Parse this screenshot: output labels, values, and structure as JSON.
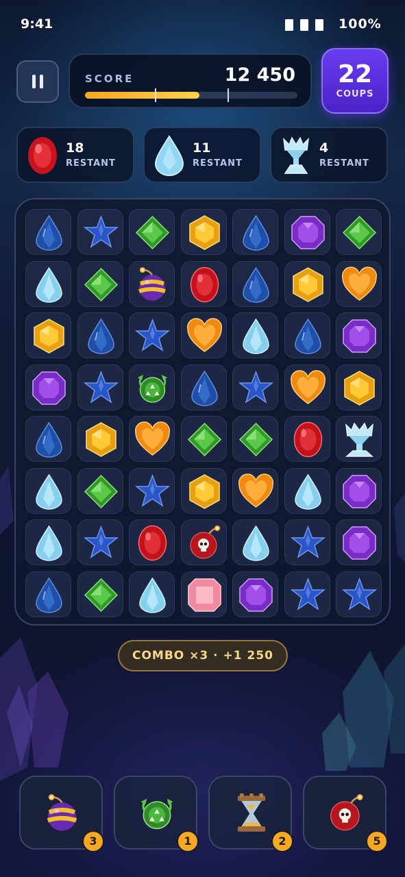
{
  "status_bar": {
    "time": "9:41",
    "battery": "100%"
  },
  "header": {
    "score_label": "SCORE",
    "score_value": "12 450",
    "score_progress": 0.54,
    "score_markers": [
      0.33,
      0.67
    ],
    "moves_value": "22",
    "moves_label": "COUPS"
  },
  "objectives": [
    {
      "icon": "red-gem-icon",
      "count": "18",
      "label": "RESTANT"
    },
    {
      "icon": "ice-drop-icon",
      "count": "11",
      "label": "RESTANT"
    },
    {
      "icon": "ice-chalice-icon",
      "count": "4",
      "label": "RESTANT"
    }
  ],
  "board": {
    "rows": [
      [
        "blue-drop",
        "blue-star",
        "green-diamond",
        "yellow-hex",
        "blue-drop",
        "purple-octagon",
        "green-diamond"
      ],
      [
        "ice-drop",
        "green-diamond",
        "bomb",
        "red-oval",
        "blue-drop",
        "yellow-hex",
        "orange-heart"
      ],
      [
        "yellow-hex",
        "blue-drop",
        "blue-star",
        "orange-heart",
        "ice-drop",
        "blue-drop",
        "purple-octagon"
      ],
      [
        "purple-octagon",
        "blue-star",
        "shuffle",
        "blue-drop",
        "blue-star",
        "orange-heart",
        "yellow-hex"
      ],
      [
        "blue-drop",
        "yellow-hex",
        "orange-heart",
        "green-diamond",
        "green-diamond",
        "red-oval",
        "ice-chalice"
      ],
      [
        "ice-drop",
        "green-diamond",
        "blue-star",
        "yellow-hex",
        "orange-heart",
        "ice-drop",
        "purple-octagon"
      ],
      [
        "ice-drop",
        "blue-star",
        "red-oval",
        "skull-bomb",
        "ice-drop",
        "blue-star",
        "purple-octagon"
      ],
      [
        "blue-drop",
        "green-diamond",
        "ice-drop",
        "pink-square",
        "purple-octagon",
        "blue-star",
        "blue-star"
      ]
    ]
  },
  "combo": {
    "text": "COMBO ×3 · +1 250"
  },
  "boosters": [
    {
      "icon": "bomb",
      "name": "bomb-booster",
      "count": "3"
    },
    {
      "icon": "shuffle",
      "name": "shuffle-booster",
      "count": "1"
    },
    {
      "icon": "hourglass",
      "name": "hourglass-booster",
      "count": "2"
    },
    {
      "icon": "skull-bomb",
      "name": "skull-bomb-booster",
      "count": "5"
    }
  ],
  "colors": {
    "accent_purple": "#5b2ee0",
    "progress_gold": "#f4a623",
    "badge_gold": "#f5a821"
  }
}
